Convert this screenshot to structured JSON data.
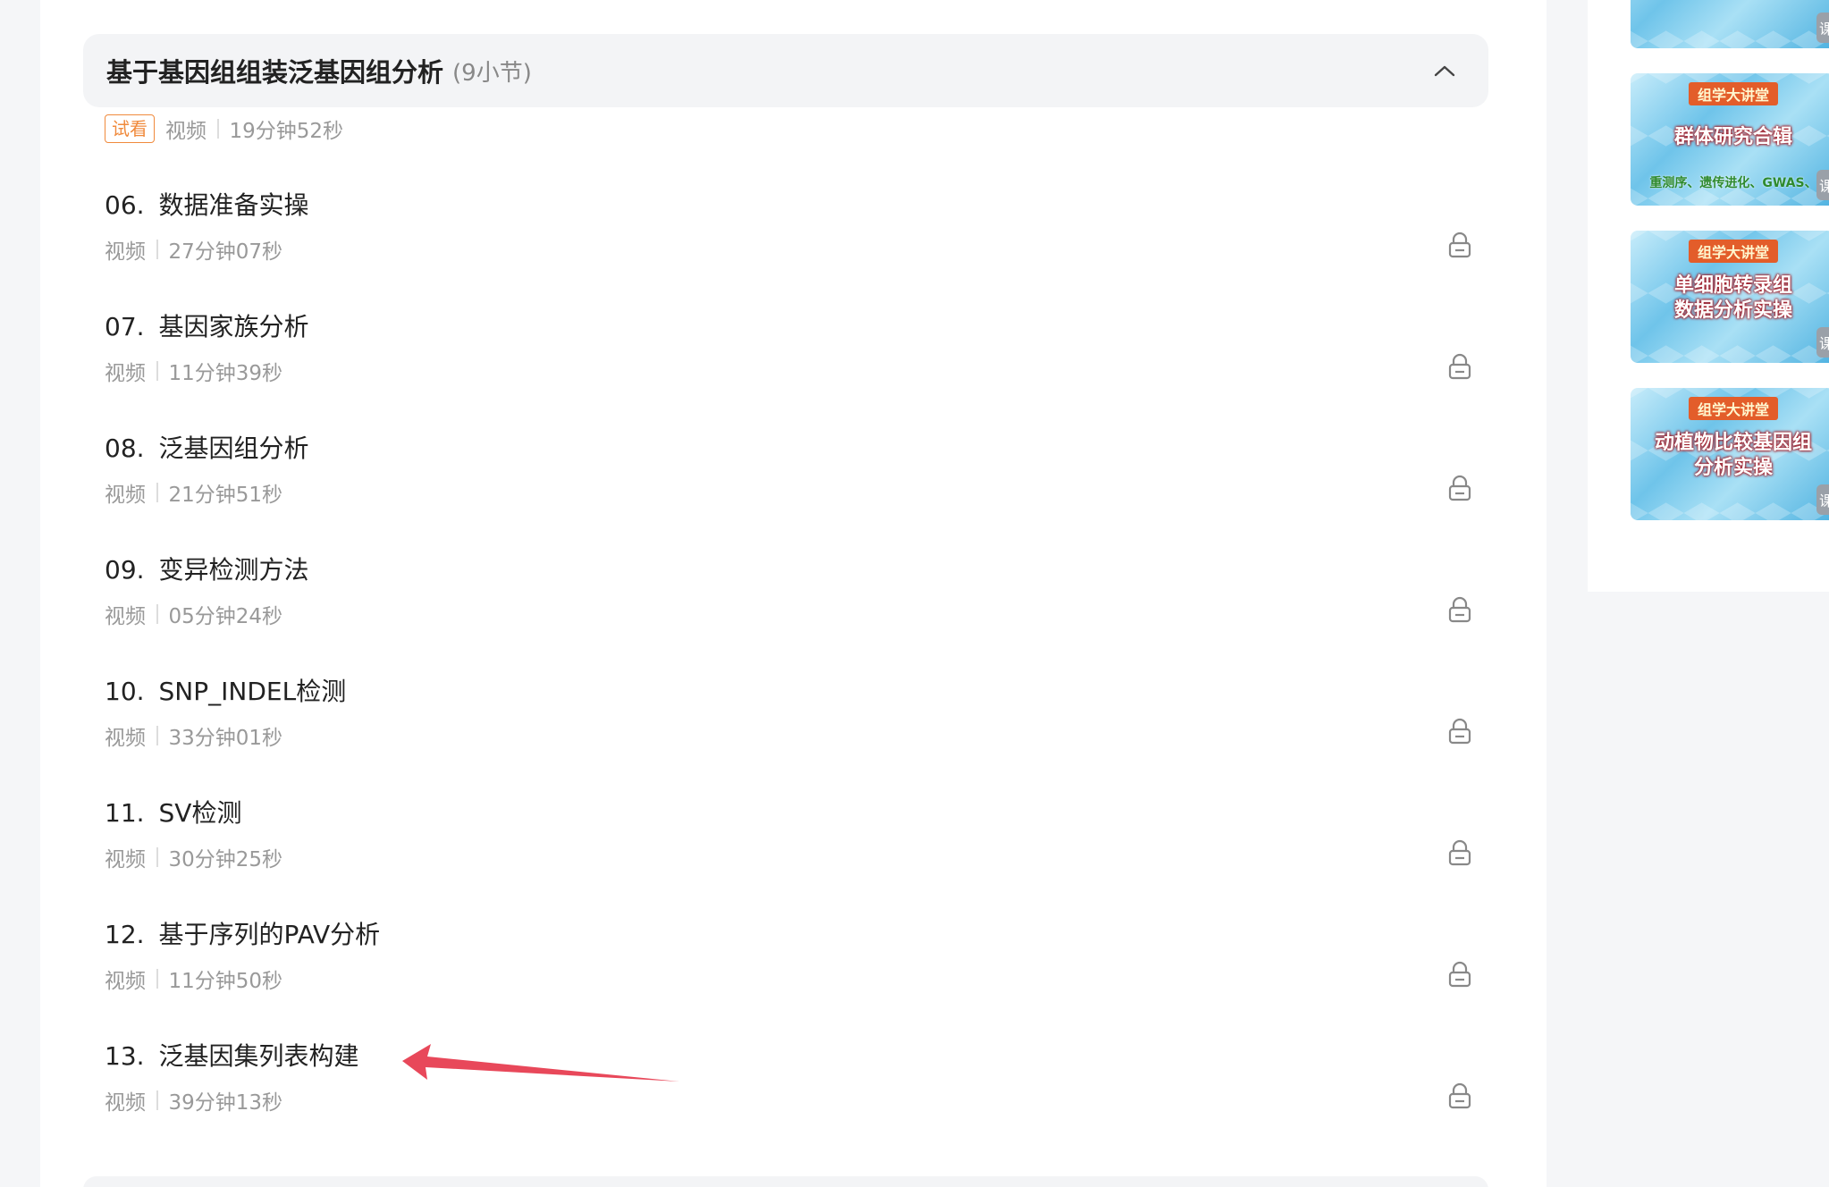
{
  "section": {
    "title": "基于基因组组装泛基因组分析",
    "count": "(9小节)"
  },
  "trial": {
    "badge": "试看",
    "type": "视频",
    "duration": "19分钟52秒"
  },
  "lessons": [
    {
      "num": "06.",
      "title": "数据准备实操",
      "type": "视频",
      "duration": "27分钟07秒"
    },
    {
      "num": "07.",
      "title": "基因家族分析",
      "type": "视频",
      "duration": "11分钟39秒"
    },
    {
      "num": "08.",
      "title": "泛基因组分析",
      "type": "视频",
      "duration": "21分钟51秒"
    },
    {
      "num": "09.",
      "title": "变异检测方法",
      "type": "视频",
      "duration": "05分钟24秒"
    },
    {
      "num": "10.",
      "title": "SNP_INDEL检测",
      "type": "视频",
      "duration": "33分钟01秒"
    },
    {
      "num": "11.",
      "title": "SV检测",
      "type": "视频",
      "duration": "30分钟25秒"
    },
    {
      "num": "12.",
      "title": "基于序列的PAV分析",
      "type": "视频",
      "duration": "11分钟50秒"
    },
    {
      "num": "13.",
      "title": "泛基因集列表构建",
      "type": "视频",
      "duration": "39分钟13秒"
    }
  ],
  "sidebar": {
    "courses": [
      {
        "tag": "",
        "title": "",
        "sub": "",
        "corner": "课"
      },
      {
        "tag": "组学大讲堂",
        "title": "群体研究合辑",
        "sub": "重测序、遗传进化、GWAS、",
        "corner": "课"
      },
      {
        "tag": "组学大讲堂",
        "title": "单细胞转录组\n数据分析实操",
        "sub": "",
        "corner": "课"
      },
      {
        "tag": "组学大讲堂",
        "title": "动植物比较基因组\n分析实操",
        "sub": "",
        "corner": "课"
      }
    ]
  },
  "colors": {
    "accent_orange": "#f08a3c",
    "annotation_arrow": "#e8485a",
    "muted_text": "#999999"
  }
}
